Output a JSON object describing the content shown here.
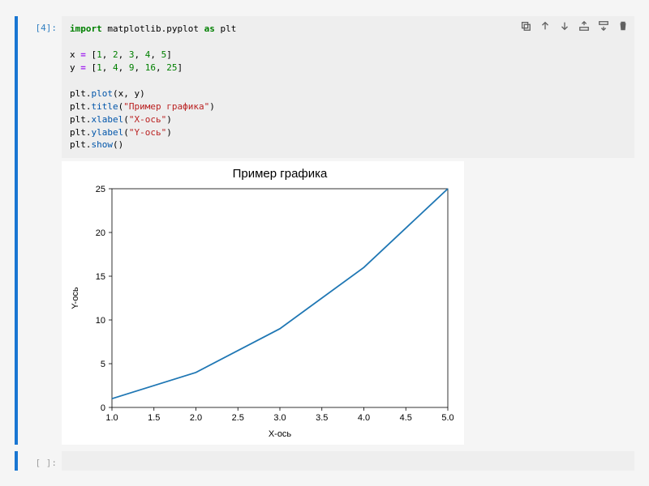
{
  "cells": [
    {
      "prompt": "[4]:",
      "code_tokens": [
        {
          "t": "import ",
          "c": "kw"
        },
        {
          "t": "matplotlib.pyplot ",
          "c": "nm"
        },
        {
          "t": "as ",
          "c": "kw"
        },
        {
          "t": "plt",
          "c": "nm"
        },
        {
          "t": "\n\n",
          "c": "nm"
        },
        {
          "t": "x ",
          "c": "nm"
        },
        {
          "t": "= ",
          "c": "op"
        },
        {
          "t": "[",
          "c": "nm"
        },
        {
          "t": "1",
          "c": "num"
        },
        {
          "t": ", ",
          "c": "nm"
        },
        {
          "t": "2",
          "c": "num"
        },
        {
          "t": ", ",
          "c": "nm"
        },
        {
          "t": "3",
          "c": "num"
        },
        {
          "t": ", ",
          "c": "nm"
        },
        {
          "t": "4",
          "c": "num"
        },
        {
          "t": ", ",
          "c": "nm"
        },
        {
          "t": "5",
          "c": "num"
        },
        {
          "t": "]\n",
          "c": "nm"
        },
        {
          "t": "y ",
          "c": "nm"
        },
        {
          "t": "= ",
          "c": "op"
        },
        {
          "t": "[",
          "c": "nm"
        },
        {
          "t": "1",
          "c": "num"
        },
        {
          "t": ", ",
          "c": "nm"
        },
        {
          "t": "4",
          "c": "num"
        },
        {
          "t": ", ",
          "c": "nm"
        },
        {
          "t": "9",
          "c": "num"
        },
        {
          "t": ", ",
          "c": "nm"
        },
        {
          "t": "16",
          "c": "num"
        },
        {
          "t": ", ",
          "c": "nm"
        },
        {
          "t": "25",
          "c": "num"
        },
        {
          "t": "]\n\n",
          "c": "nm"
        },
        {
          "t": "plt",
          "c": "nm"
        },
        {
          "t": ".",
          "c": "nm"
        },
        {
          "t": "plot",
          "c": "fn"
        },
        {
          "t": "(x, y)\n",
          "c": "nm"
        },
        {
          "t": "plt",
          "c": "nm"
        },
        {
          "t": ".",
          "c": "nm"
        },
        {
          "t": "title",
          "c": "fn"
        },
        {
          "t": "(",
          "c": "nm"
        },
        {
          "t": "\"Пример графика\"",
          "c": "str"
        },
        {
          "t": ")\n",
          "c": "nm"
        },
        {
          "t": "plt",
          "c": "nm"
        },
        {
          "t": ".",
          "c": "nm"
        },
        {
          "t": "xlabel",
          "c": "fn"
        },
        {
          "t": "(",
          "c": "nm"
        },
        {
          "t": "\"X-ось\"",
          "c": "str"
        },
        {
          "t": ")\n",
          "c": "nm"
        },
        {
          "t": "plt",
          "c": "nm"
        },
        {
          "t": ".",
          "c": "nm"
        },
        {
          "t": "ylabel",
          "c": "fn"
        },
        {
          "t": "(",
          "c": "nm"
        },
        {
          "t": "\"Y-ось\"",
          "c": "str"
        },
        {
          "t": ")\n",
          "c": "nm"
        },
        {
          "t": "plt",
          "c": "nm"
        },
        {
          "t": ".",
          "c": "nm"
        },
        {
          "t": "show",
          "c": "fn"
        },
        {
          "t": "()",
          "c": "nm"
        }
      ]
    },
    {
      "prompt": "[ ]:",
      "code_tokens": []
    }
  ],
  "toolbar": {
    "duplicate": "duplicate",
    "up": "up",
    "down": "down",
    "insert_above": "insert-above",
    "insert_below": "insert-below",
    "delete": "delete"
  },
  "chart_data": {
    "type": "line",
    "title": "Пример графика",
    "xlabel": "X-ось",
    "ylabel": "Y-ось",
    "x": [
      1,
      2,
      3,
      4,
      5
    ],
    "y": [
      1,
      4,
      9,
      16,
      25
    ],
    "xlim": [
      1.0,
      5.0
    ],
    "ylim": [
      0,
      25
    ],
    "xticks": [
      1.0,
      1.5,
      2.0,
      2.5,
      3.0,
      3.5,
      4.0,
      4.5,
      5.0
    ],
    "yticks": [
      0,
      5,
      10,
      15,
      20,
      25
    ]
  }
}
